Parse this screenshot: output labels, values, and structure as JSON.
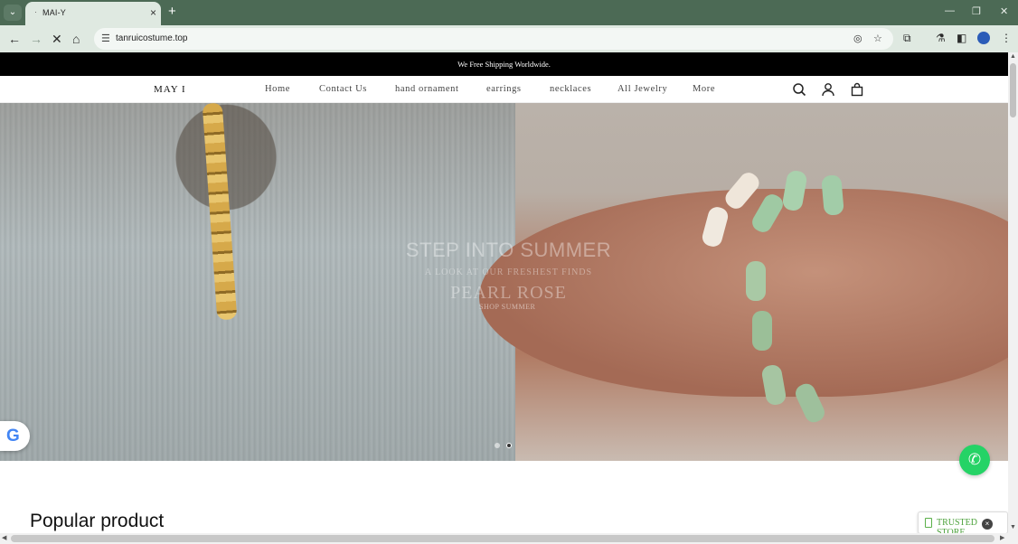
{
  "browser": {
    "tab_title": "MAI-Y",
    "url": "tanruicostume.top",
    "new_tab_label": "+",
    "tab_close": "×",
    "min_label": "—",
    "max_label": "❐",
    "close_label": "✕"
  },
  "site": {
    "announcement": "We Free Shipping Worldwide.",
    "logo": "MAY I",
    "nav": [
      "Home",
      "Contact Us",
      "hand ornament",
      "earrings",
      "necklaces",
      "All Jewelry",
      "More"
    ]
  },
  "hero": {
    "title": "STEP INTO SUMMER",
    "subtitle": "A LOOK AT OUR FRESHEST FINDS",
    "brand": "PEARL ROSE",
    "cta": "SHOP SUMMER",
    "slide_count": 2,
    "active_slide": 2
  },
  "section": {
    "popular_title": "Popular product"
  },
  "widgets": {
    "trusted_store": "TRUSTED STORE",
    "google_letter": "G",
    "whatsapp_icon": "whatsapp-icon"
  },
  "colors": {
    "chrome_bg": "#4c6a55",
    "toolbar_bg": "#dfe9e1",
    "announce_bg": "#000000",
    "whatsapp": "#25d366",
    "trusted_green": "#4da23c"
  }
}
